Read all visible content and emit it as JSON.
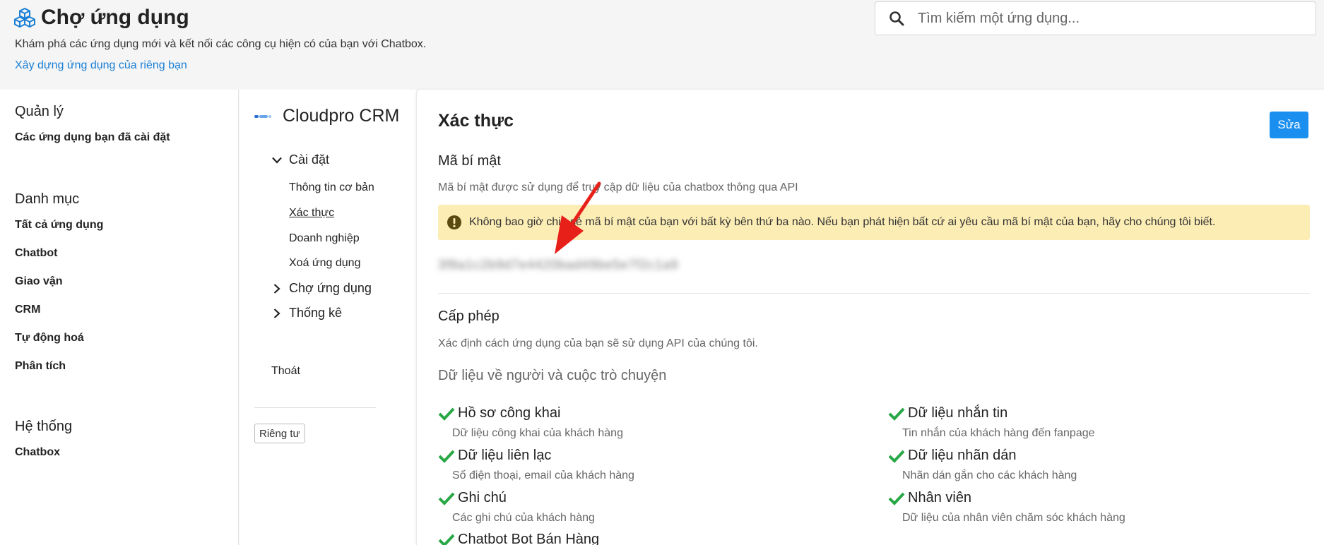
{
  "header": {
    "title": "Chợ ứng dụng",
    "subtitle": "Khám phá các ứng dụng mới và kết nối các công cụ hiện có của bạn với Chatbox.",
    "build_link": "Xây dựng ứng dụng của riêng bạn",
    "search_placeholder": "Tìm kiếm một ứng dụng..."
  },
  "sidebar": {
    "manage": {
      "heading": "Quản lý",
      "items": [
        "Các ứng dụng bạn đã cài đặt"
      ]
    },
    "categories": {
      "heading": "Danh mục",
      "items": [
        "Tất cả ứng dụng",
        "Chatbot",
        "Giao vận",
        "CRM",
        "Tự động hoá",
        "Phân tích"
      ]
    },
    "system": {
      "heading": "Hệ thống",
      "items": [
        "Chatbox"
      ]
    }
  },
  "subnav": {
    "app_name": "Cloudpro CRM",
    "settings": "Cài đặt",
    "settings_items": [
      "Thông tin cơ bản",
      "Xác thực",
      "Doanh nghiệp",
      "Xoá ứng dụng"
    ],
    "marketplace": "Chợ ứng dụng",
    "stats": "Thống kê",
    "exit": "Thoát",
    "private_btn": "Riêng tư"
  },
  "panel": {
    "title": "Xác thực",
    "edit_btn": "Sửa",
    "secret": {
      "title": "Mã bí mật",
      "desc": "Mã bí mật được sử dụng để truy cập dữ liệu của chatbox thông qua API",
      "warning": "Không bao giờ chia sẻ mã bí mật của bạn với bất kỳ bên thứ ba nào. Nếu bạn phát hiện bất cứ ai yêu cầu mã bí mật của bạn, hãy cho chúng tôi biết.",
      "value": "3f8a1c2b9d7e4420bad49be5e7f2c1a9"
    },
    "license": {
      "title": "Cấp phép",
      "desc": "Xác định cách ứng dụng của bạn sẽ sử dụng API của chúng tôi.",
      "group_title": "Dữ liệu về người và cuộc trò chuyện",
      "perms_left": [
        {
          "title": "Hồ sơ công khai",
          "desc": "Dữ liệu công khai của khách hàng"
        },
        {
          "title": "Dữ liệu liên lạc",
          "desc": "Số điện thoại, email của khách hàng"
        },
        {
          "title": "Ghi chú",
          "desc": "Các ghi chú của khách hàng"
        },
        {
          "title": "Chatbot Bot Bán Hàng",
          "desc": ""
        }
      ],
      "perms_right": [
        {
          "title": "Dữ liệu nhắn tin",
          "desc": "Tin nhắn của khách hàng đến fanpage"
        },
        {
          "title": "Dữ liệu nhãn dán",
          "desc": "Nhãn dán gắn cho các khách hàng"
        },
        {
          "title": "Nhân viên",
          "desc": "Dữ liệu của nhân viên chăm sóc khách hàng"
        }
      ]
    }
  },
  "colors": {
    "accent": "#1a8ff0",
    "link": "#1a7fd4",
    "check": "#28a745",
    "warning_bg": "#fcedb5",
    "arrow": "#e8201a"
  }
}
